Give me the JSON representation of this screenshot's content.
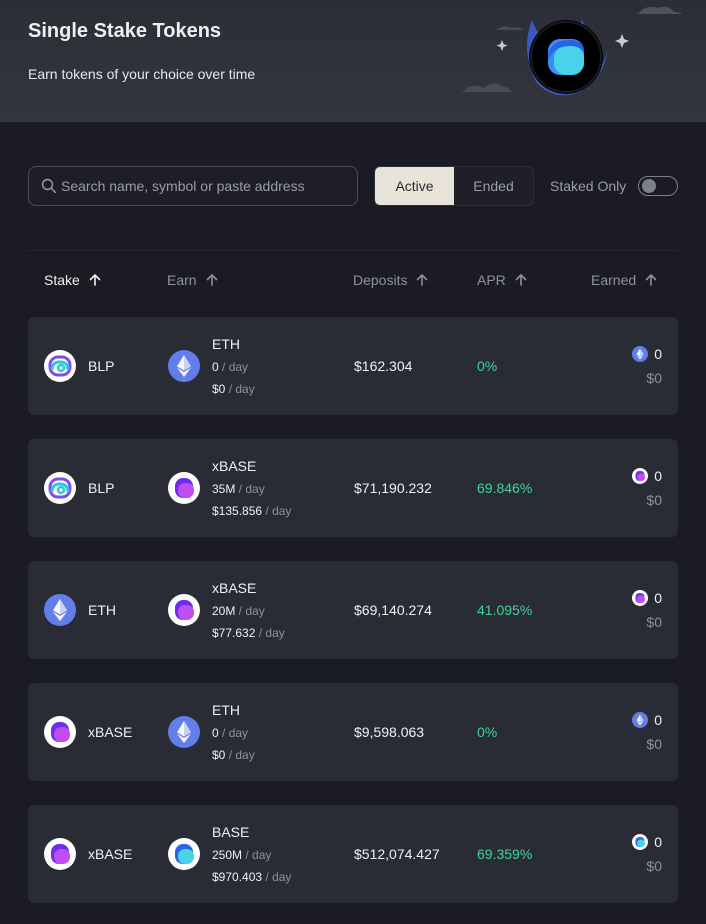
{
  "header": {
    "title": "Single Stake Tokens",
    "subtitle": "Earn tokens of your choice over time"
  },
  "search": {
    "placeholder": "Search name, symbol or paste address"
  },
  "tabs": [
    {
      "label": "Active",
      "selected": true
    },
    {
      "label": "Ended",
      "selected": false
    }
  ],
  "staked_only": {
    "label": "Staked Only",
    "on": false
  },
  "columns": {
    "stake": "Stake",
    "earn": "Earn",
    "deposits": "Deposits",
    "apr": "APR",
    "earned": "Earned"
  },
  "per_day_suffix": " / day",
  "colors": {
    "accent_green": "#3fd49a",
    "active_tab": "#e6e3d8"
  },
  "rows": [
    {
      "stake": "BLP",
      "stake_icon": "blp-icon",
      "earn": "ETH",
      "earn_icon": "eth-icon",
      "earn_amount": "0",
      "earn_usd": "$0",
      "deposits": "$162.304",
      "apr": "0%",
      "earned_amount": "0",
      "earned_usd": "$0"
    },
    {
      "stake": "BLP",
      "stake_icon": "blp-icon",
      "earn": "xBASE",
      "earn_icon": "xbase-icon",
      "earn_amount": "35M",
      "earn_usd": "$135.856",
      "deposits": "$71,190.232",
      "apr": "69.846%",
      "earned_amount": "0",
      "earned_usd": "$0"
    },
    {
      "stake": "ETH",
      "stake_icon": "eth-icon",
      "earn": "xBASE",
      "earn_icon": "xbase-icon",
      "earn_amount": "20M",
      "earn_usd": "$77.632",
      "deposits": "$69,140.274",
      "apr": "41.095%",
      "earned_amount": "0",
      "earned_usd": "$0"
    },
    {
      "stake": "xBASE",
      "stake_icon": "xbase-icon",
      "earn": "ETH",
      "earn_icon": "eth-icon",
      "earn_amount": "0",
      "earn_usd": "$0",
      "deposits": "$9,598.063",
      "apr": "0%",
      "earned_amount": "0",
      "earned_usd": "$0"
    },
    {
      "stake": "xBASE",
      "stake_icon": "xbase-icon",
      "earn": "BASE",
      "earn_icon": "base-icon",
      "earn_amount": "250M",
      "earn_usd": "$970.403",
      "deposits": "$512,074.427",
      "apr": "69.359%",
      "earned_amount": "0",
      "earned_usd": "$0"
    }
  ]
}
